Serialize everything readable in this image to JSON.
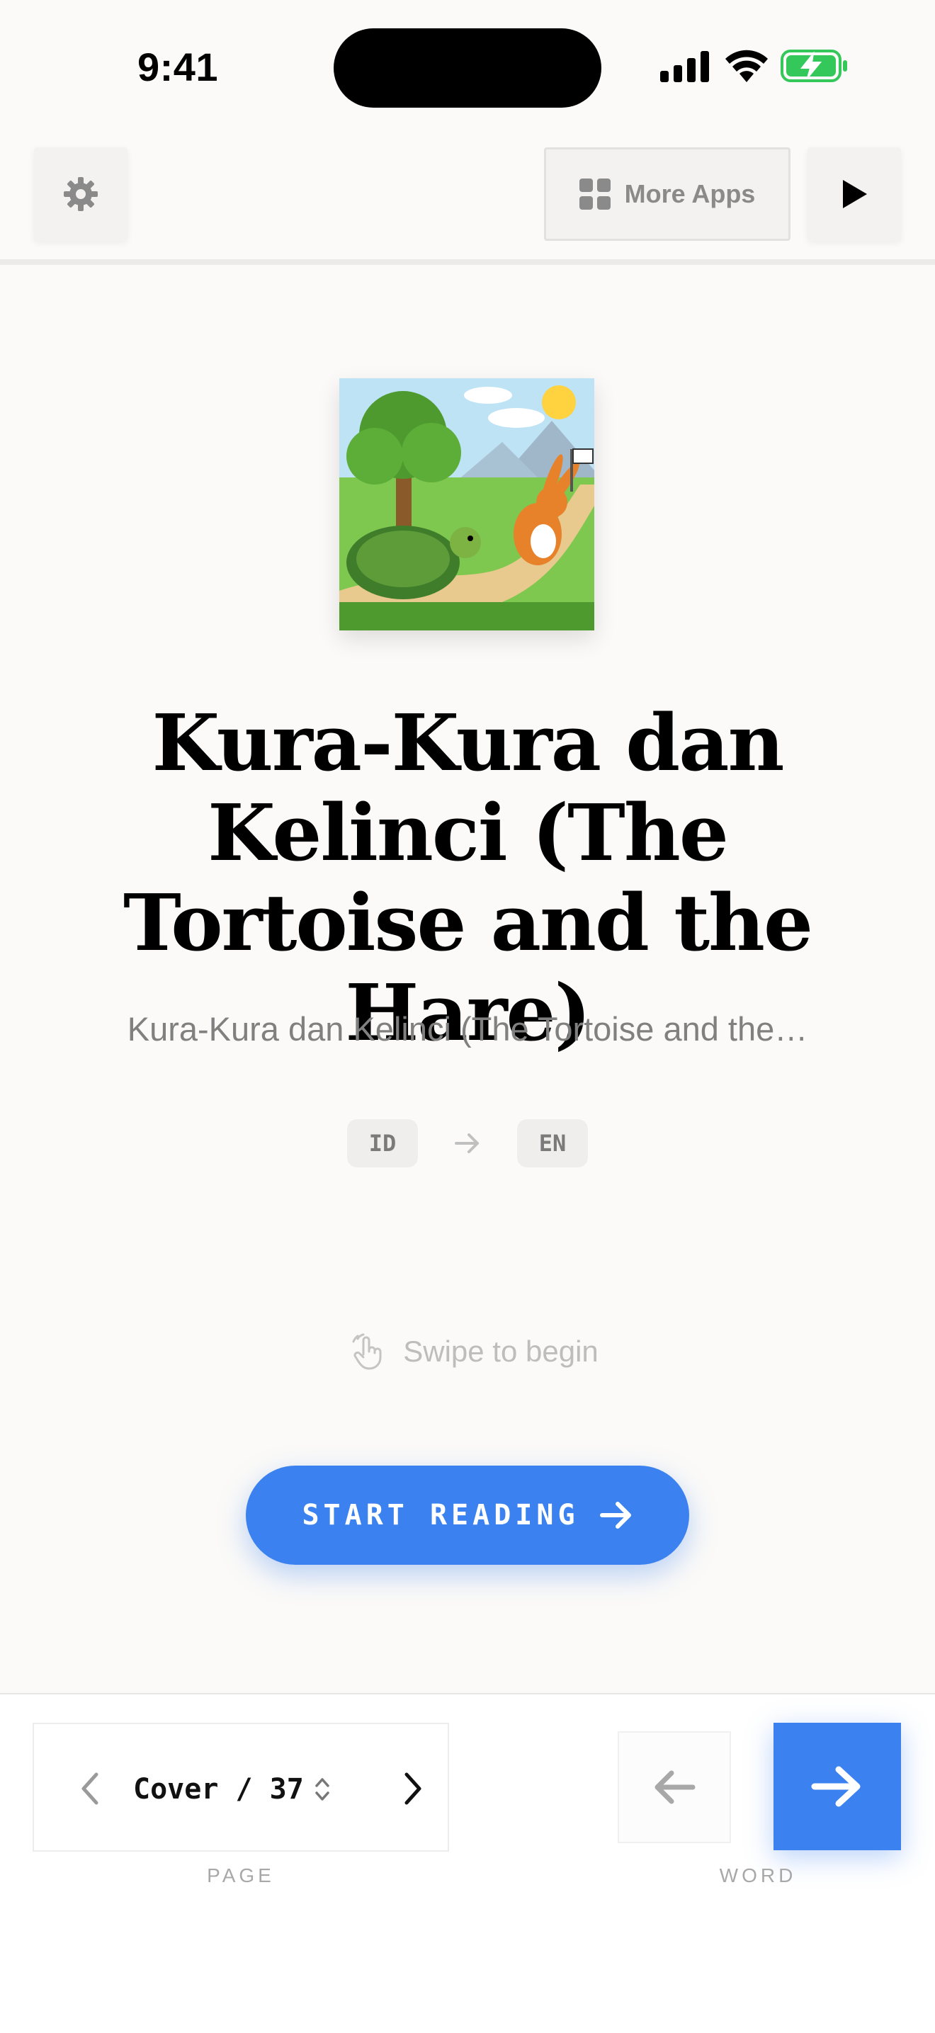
{
  "status_bar": {
    "time": "9:41",
    "icons": [
      "cellular-signal-icon",
      "wifi-icon",
      "battery-charging-icon"
    ]
  },
  "toolbar": {
    "settings_icon": "gear-icon",
    "more_apps_label": "More Apps",
    "more_apps_icon": "grid-icon",
    "play_icon": "play-icon"
  },
  "book": {
    "cover_icon": "tortoise-and-hare-illustration",
    "title": "Kura-Kura dan Kelinci (The Tortoise and the Hare)",
    "subtitle": "Kura-Kura dan Kelinci (The Tortoise and the…",
    "source_lang": "ID",
    "target_lang": "EN"
  },
  "hint": {
    "label": "Swipe to begin",
    "icon": "hand-pointer-icon"
  },
  "start_button": {
    "label": "START READING"
  },
  "bottom_bar": {
    "page_indicator": "Cover / 37",
    "page_caption": "PAGE",
    "word_caption": "WORD"
  },
  "colors": {
    "accent": "#3B82F0",
    "background": "#FBFAF8",
    "battery": "#34C759"
  }
}
